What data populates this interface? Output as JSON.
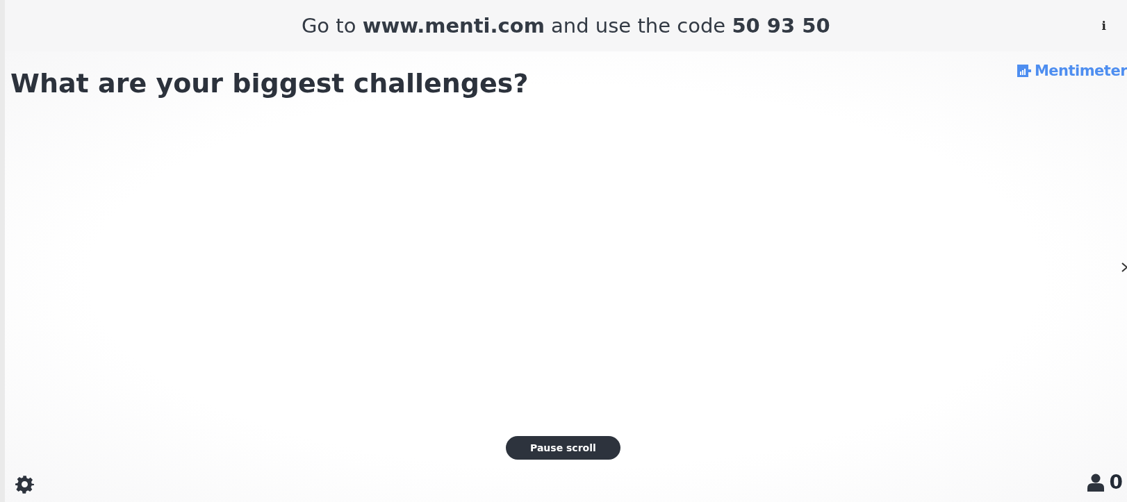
{
  "banner": "Go to **www.menti.com** and use the code **50 93 50**",
  "info_button": "i",
  "brand": "Mentimeter",
  "title": "What are your biggest challenges?",
  "pause_button": "Pause scroll",
  "participants": "0"
}
